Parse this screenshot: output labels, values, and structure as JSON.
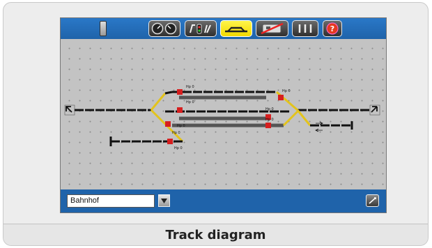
{
  "caption": "Track diagram",
  "station_field": {
    "value": "Bahnhof"
  },
  "signal_labels": [
    "Hp 0",
    "Hp 0",
    "Hp 0",
    "Hp 0",
    "Hp 0",
    "Hp 0",
    "Hp 0",
    "Hp 0"
  ],
  "colors": {
    "toolbar": "#2066b0",
    "grid": "#c3c3c3",
    "track": "#111111",
    "turnout": "#e3c31c",
    "signal": "#d61f1f",
    "active_tab": "#f5e000"
  }
}
